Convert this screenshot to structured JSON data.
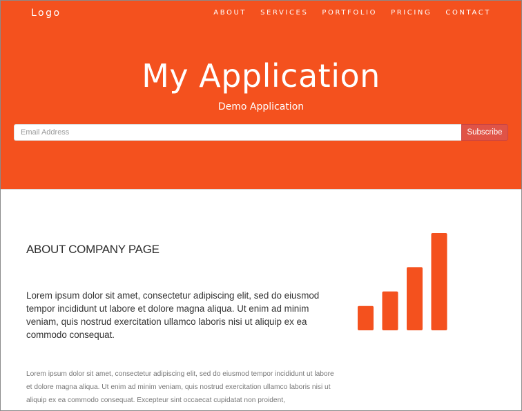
{
  "nav": {
    "logo": "Logo",
    "items": [
      "ABOUT",
      "SERVICES",
      "PORTFOLIO",
      "PRICING",
      "CONTACT"
    ]
  },
  "hero": {
    "title": "My Application",
    "subtitle": "Demo Application",
    "email_placeholder": "Email Address",
    "subscribe_label": "Subscribe"
  },
  "about": {
    "title": "ABOUT COMPANY PAGE",
    "lead": "Lorem ipsum dolor sit amet, consectetur adipiscing elit, sed do eiusmod tempor incididunt ut labore et dolore magna aliqua. Ut enim ad minim veniam, quis nostrud exercitation ullamco laboris nisi ut aliquip ex ea commodo consequat.",
    "body": "Lorem ipsum dolor sit amet, consectetur adipiscing elit, sed do eiusmod tempor incididunt ut labore et dolore magna aliqua. Ut enim ad minim veniam, quis nostrud exercitation ullamco laboris nisi ut aliquip ex ea commodo consequat. Excepteur sint occaecat cupidatat non proident,"
  },
  "icon": {
    "name": "signal-bars-icon",
    "bar_levels": [
      0.25,
      0.4,
      0.65,
      1.0
    ]
  },
  "colors": {
    "brand": "#f4511e",
    "subscribe": "#e05346",
    "heading": "#2e2e2e",
    "lead_text": "#333333",
    "body_text": "#777777"
  }
}
